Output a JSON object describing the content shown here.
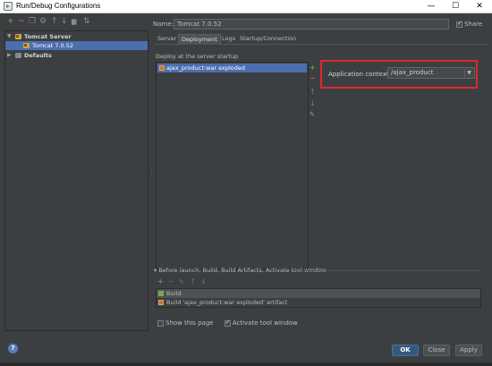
{
  "window": {
    "title": "Run/Debug Configurations",
    "minimize": "—",
    "maximize": "☐",
    "close": "✕"
  },
  "left_toolbar": {
    "add": "+",
    "remove": "−",
    "copy": "❐",
    "settings": "⚙",
    "up": "↑",
    "down": "↓",
    "folder": "▆",
    "sort": "⇅"
  },
  "tree": {
    "items": [
      {
        "label": "Tomcat Server",
        "expanded": true,
        "bold": true
      },
      {
        "label": "Tomcat 7.0.52",
        "selected": true
      },
      {
        "label": "Defaults",
        "expanded": false,
        "bold": true
      }
    ]
  },
  "config": {
    "name_label": "Name:",
    "name_value": "Tomcat 7.0.52",
    "share_label": "Share",
    "share_checked": true
  },
  "tabs": [
    "Server",
    "Deployment",
    "Logs",
    "Startup/Connection"
  ],
  "active_tab": "Deployment",
  "deployment": {
    "section_label": "Deploy at the server startup",
    "items": [
      "ajax_product:war exploded"
    ],
    "tools": {
      "add": "+",
      "remove": "−",
      "up": "↑",
      "down": "↓",
      "edit": "✎"
    },
    "context_label": "Application context:",
    "context_value": "/ajax_product",
    "highlight_color": "#e0282e"
  },
  "before_launch": {
    "header": "Before launch: Build, Build Artifacts, Activate tool window",
    "tools": {
      "add": "+",
      "remove": "−",
      "edit": "✎",
      "up": "↑",
      "down": "↓"
    },
    "items": [
      {
        "label": "Build"
      },
      {
        "label": "Build 'ajax_product:war exploded' artifact"
      }
    ]
  },
  "options": {
    "show_page_label": "Show this page",
    "show_page_checked": false,
    "activate_label": "Activate tool window",
    "activate_checked": true
  },
  "footer": {
    "help": "?",
    "ok": "OK",
    "close": "Close",
    "apply": "Apply"
  },
  "colors": {
    "background": "#3c3f41",
    "selection": "#4b6eaf",
    "primary_button": "#365880"
  }
}
